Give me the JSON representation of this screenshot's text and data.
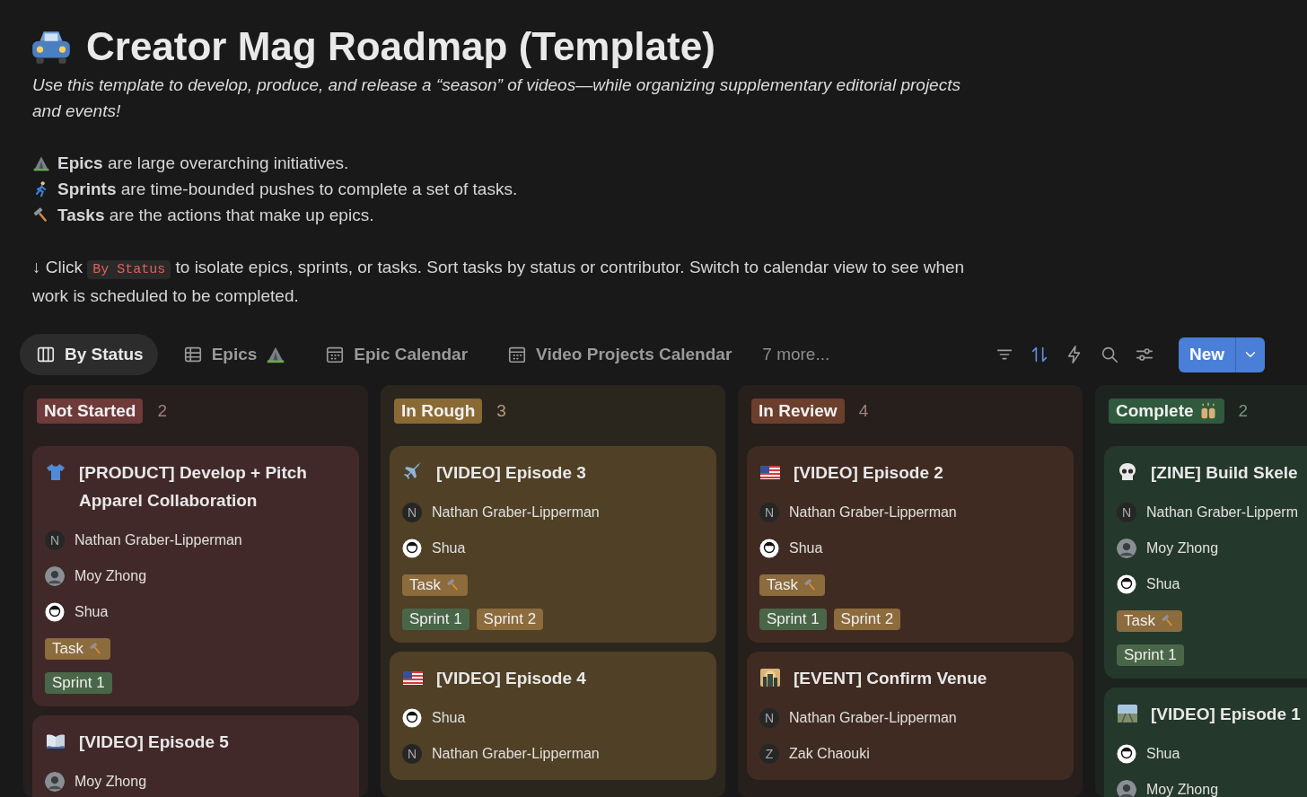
{
  "title": "Creator Mag Roadmap (Template)",
  "intro": "Use this template to develop, produce, and release a “season” of videos—while organizing supplementary editorial projects and events!",
  "legend": [
    "**Epics** are large overarching initiatives.",
    "**Sprints** are time-bounded pushes to complete a set of tasks.",
    "**Tasks** are the actions that make up epics."
  ],
  "hint": {
    "before": "↓ Click",
    "code": "By Status",
    "after": "to isolate epics, sprints, or tasks. Sort tasks by status or contributor. Switch to calendar view to see when work is scheduled to be completed."
  },
  "tabs": [
    {
      "label": "By Status",
      "kind": "board",
      "selected": true
    },
    {
      "label": "Epics",
      "kind": "table",
      "selected": false
    },
    {
      "label": "Epic Calendar",
      "kind": "calendar",
      "selected": false
    },
    {
      "label": "Video Projects Calendar",
      "kind": "calendar",
      "selected": false
    }
  ],
  "more_views": "7 more...",
  "new_button": "New",
  "columns": [
    {
      "status": "Not Started",
      "color": "#6e3a3a",
      "count": "2",
      "cards": [
        {
          "title": "[PRODUCT] Develop + Pitch Apparel Collaboration",
          "people": [
            {
              "name": "Nathan Graber-Lipperman",
              "kind": "initial",
              "initial": "N"
            },
            {
              "name": "Moy Zhong",
              "kind": "photo"
            },
            {
              "name": "Shua",
              "kind": "drawing"
            }
          ],
          "type": {
            "label": "Task",
            "color": "#8c6b3c"
          },
          "sprints": [
            {
              "label": "Sprint 1",
              "color": "#4a6648"
            }
          ]
        },
        {
          "title": "[VIDEO] Episode 5",
          "people": [
            {
              "name": "Moy Zhong",
              "kind": "photo"
            }
          ]
        }
      ]
    },
    {
      "status": "In Rough",
      "color": "#8a6a34",
      "count": "3",
      "cards": [
        {
          "title": "[VIDEO] Episode 3",
          "people": [
            {
              "name": "Nathan Graber-Lipperman",
              "kind": "initial",
              "initial": "N"
            },
            {
              "name": "Shua",
              "kind": "drawing"
            }
          ],
          "type": {
            "label": "Task",
            "color": "#8c6b3c"
          },
          "sprints": [
            {
              "label": "Sprint 1",
              "color": "#4a6648"
            },
            {
              "label": "Sprint 2",
              "color": "#8c6b3c"
            }
          ]
        },
        {
          "title": "[VIDEO] Episode 4",
          "people": [
            {
              "name": "Shua",
              "kind": "drawing"
            },
            {
              "name": "Nathan Graber-Lipperman",
              "kind": "initial",
              "initial": "N"
            }
          ]
        }
      ]
    },
    {
      "status": "In Review",
      "color": "#6b3f2c",
      "count": "4",
      "cards": [
        {
          "title": "[VIDEO] Episode 2",
          "people": [
            {
              "name": "Nathan Graber-Lipperman",
              "kind": "initial",
              "initial": "N"
            },
            {
              "name": "Shua",
              "kind": "drawing"
            }
          ],
          "type": {
            "label": "Task",
            "color": "#8c6b3c"
          },
          "sprints": [
            {
              "label": "Sprint 1",
              "color": "#4a6648"
            },
            {
              "label": "Sprint 2",
              "color": "#8c6b3c"
            }
          ]
        },
        {
          "title": "[EVENT] Confirm Venue",
          "people": [
            {
              "name": "Nathan Graber-Lipperman",
              "kind": "initial",
              "initial": "N"
            },
            {
              "name": "Zak Chaouki",
              "kind": "initial",
              "initial": "Z"
            }
          ]
        }
      ]
    },
    {
      "status": "Complete",
      "color": "#2f5a3e",
      "count": "2",
      "cards": [
        {
          "title": "[ZINE] Build Skele",
          "people": [
            {
              "name": "Nathan Graber-Lipperm",
              "kind": "initial",
              "initial": "N"
            },
            {
              "name": "Moy Zhong",
              "kind": "photo"
            },
            {
              "name": "Shua",
              "kind": "drawing"
            }
          ],
          "type": {
            "label": "Task",
            "color": "#8c6b3c"
          },
          "sprints": [
            {
              "label": "Sprint 1",
              "color": "#4a6648"
            }
          ]
        },
        {
          "title": "[VIDEO] Episode 1",
          "people": [
            {
              "name": "Shua",
              "kind": "drawing"
            },
            {
              "name": "Moy Zhong",
              "kind": "photo"
            }
          ]
        }
      ]
    }
  ]
}
